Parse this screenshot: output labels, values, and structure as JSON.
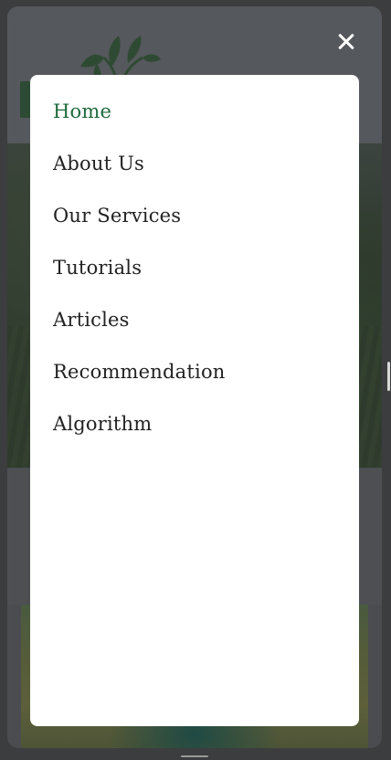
{
  "overlay": {
    "close_icon": "close-icon"
  },
  "menu": {
    "items": [
      {
        "label": "Home",
        "active": true
      },
      {
        "label": "About Us",
        "active": false
      },
      {
        "label": "Our Services",
        "active": false
      },
      {
        "label": "Tutorials",
        "active": false
      },
      {
        "label": "Articles",
        "active": false
      },
      {
        "label": "Recommendation",
        "active": false
      },
      {
        "label": "Algorithm",
        "active": false
      }
    ],
    "active_color": "#1e6a3e",
    "text_color": "#222222"
  },
  "logo": {
    "icon": "leaf-logo-icon",
    "color": "#2c4a34"
  }
}
